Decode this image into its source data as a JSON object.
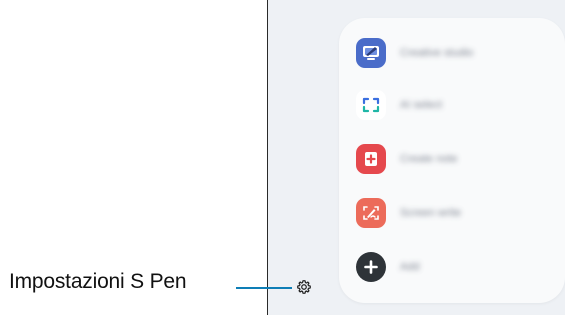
{
  "callout": {
    "label": "Impostazioni S Pen"
  },
  "menu": {
    "items": [
      {
        "label": "Creative studio",
        "icon": "creative-studio-icon",
        "color": "#4a6cc9"
      },
      {
        "label": "AI select",
        "icon": "ai-select-icon",
        "color": "#3b6fe0"
      },
      {
        "label": "Create note",
        "icon": "create-note-icon",
        "color": "#e5484d"
      },
      {
        "label": "Screen write",
        "icon": "screen-write-icon",
        "color": "#ec6b5a"
      },
      {
        "label": "Add",
        "icon": "add-icon",
        "color": "#2e3338"
      }
    ]
  },
  "settings": {
    "icon": "gear-icon"
  },
  "colors": {
    "callout_line": "#0e7eb6",
    "panel_background": "#f9fafb",
    "screen_background": "#eef1f5"
  }
}
